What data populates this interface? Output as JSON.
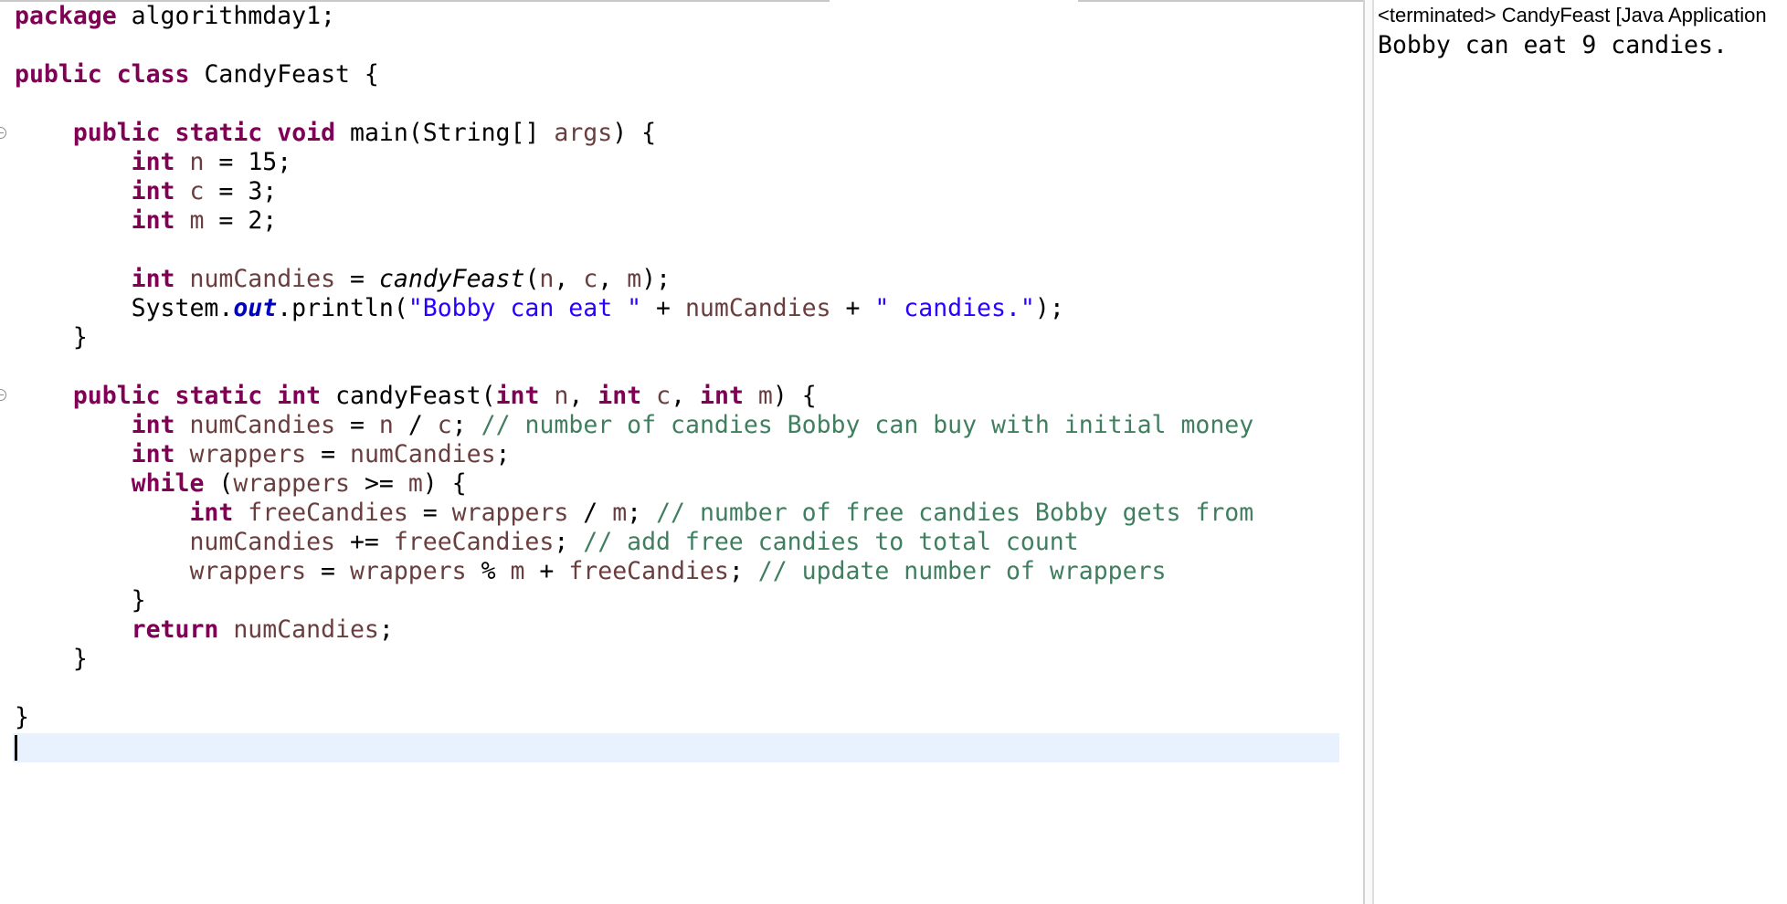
{
  "editor": {
    "lines": [
      {
        "tokens": [
          {
            "t": "package",
            "c": "kw"
          },
          {
            "t": " algorithmday1;"
          }
        ]
      },
      {
        "tokens": []
      },
      {
        "tokens": [
          {
            "t": "public",
            "c": "kw"
          },
          {
            "t": " "
          },
          {
            "t": "class",
            "c": "kw"
          },
          {
            "t": " CandyFeast {"
          }
        ]
      },
      {
        "tokens": []
      },
      {
        "tokens": [
          {
            "t": "    "
          },
          {
            "t": "public",
            "c": "kw"
          },
          {
            "t": " "
          },
          {
            "t": "static",
            "c": "kw"
          },
          {
            "t": " "
          },
          {
            "t": "void",
            "c": "kw"
          },
          {
            "t": " main(String[] "
          },
          {
            "t": "args",
            "c": "var"
          },
          {
            "t": ") {"
          }
        ]
      },
      {
        "tokens": [
          {
            "t": "        "
          },
          {
            "t": "int",
            "c": "kw"
          },
          {
            "t": " "
          },
          {
            "t": "n",
            "c": "var"
          },
          {
            "t": " = 15;"
          }
        ]
      },
      {
        "tokens": [
          {
            "t": "        "
          },
          {
            "t": "int",
            "c": "kw"
          },
          {
            "t": " "
          },
          {
            "t": "c",
            "c": "var"
          },
          {
            "t": " = 3;"
          }
        ]
      },
      {
        "tokens": [
          {
            "t": "        "
          },
          {
            "t": "int",
            "c": "kw"
          },
          {
            "t": " "
          },
          {
            "t": "m",
            "c": "var"
          },
          {
            "t": " = 2;"
          }
        ]
      },
      {
        "tokens": []
      },
      {
        "tokens": [
          {
            "t": "        "
          },
          {
            "t": "int",
            "c": "kw"
          },
          {
            "t": " "
          },
          {
            "t": "numCandies",
            "c": "var"
          },
          {
            "t": " = "
          },
          {
            "t": "candyFeast",
            "c": "ital"
          },
          {
            "t": "("
          },
          {
            "t": "n",
            "c": "var"
          },
          {
            "t": ", "
          },
          {
            "t": "c",
            "c": "var"
          },
          {
            "t": ", "
          },
          {
            "t": "m",
            "c": "var"
          },
          {
            "t": ");"
          }
        ]
      },
      {
        "tokens": [
          {
            "t": "        System."
          },
          {
            "t": "out",
            "c": "fld"
          },
          {
            "t": ".println("
          },
          {
            "t": "\"Bobby can eat \"",
            "c": "str"
          },
          {
            "t": " + "
          },
          {
            "t": "numCandies",
            "c": "var"
          },
          {
            "t": " + "
          },
          {
            "t": "\" candies.\"",
            "c": "str"
          },
          {
            "t": ");"
          }
        ]
      },
      {
        "tokens": [
          {
            "t": "    }"
          }
        ]
      },
      {
        "tokens": []
      },
      {
        "tokens": [
          {
            "t": "    "
          },
          {
            "t": "public",
            "c": "kw"
          },
          {
            "t": " "
          },
          {
            "t": "static",
            "c": "kw"
          },
          {
            "t": " "
          },
          {
            "t": "int",
            "c": "kw"
          },
          {
            "t": " candyFeast("
          },
          {
            "t": "int",
            "c": "kw"
          },
          {
            "t": " "
          },
          {
            "t": "n",
            "c": "var"
          },
          {
            "t": ", "
          },
          {
            "t": "int",
            "c": "kw"
          },
          {
            "t": " "
          },
          {
            "t": "c",
            "c": "var"
          },
          {
            "t": ", "
          },
          {
            "t": "int",
            "c": "kw"
          },
          {
            "t": " "
          },
          {
            "t": "m",
            "c": "var"
          },
          {
            "t": ") {"
          }
        ]
      },
      {
        "tokens": [
          {
            "t": "        "
          },
          {
            "t": "int",
            "c": "kw"
          },
          {
            "t": " "
          },
          {
            "t": "numCandies",
            "c": "var"
          },
          {
            "t": " = "
          },
          {
            "t": "n",
            "c": "var"
          },
          {
            "t": " / "
          },
          {
            "t": "c",
            "c": "var"
          },
          {
            "t": "; "
          },
          {
            "t": "// number of candies Bobby can buy with initial money",
            "c": "cmt"
          }
        ]
      },
      {
        "tokens": [
          {
            "t": "        "
          },
          {
            "t": "int",
            "c": "kw"
          },
          {
            "t": " "
          },
          {
            "t": "wrappers",
            "c": "var"
          },
          {
            "t": " = "
          },
          {
            "t": "numCandies",
            "c": "var"
          },
          {
            "t": ";"
          }
        ]
      },
      {
        "tokens": [
          {
            "t": "        "
          },
          {
            "t": "while",
            "c": "kw"
          },
          {
            "t": " ("
          },
          {
            "t": "wrappers",
            "c": "var"
          },
          {
            "t": " >= "
          },
          {
            "t": "m",
            "c": "var"
          },
          {
            "t": ") {"
          }
        ]
      },
      {
        "tokens": [
          {
            "t": "            "
          },
          {
            "t": "int",
            "c": "kw"
          },
          {
            "t": " "
          },
          {
            "t": "freeCandies",
            "c": "var"
          },
          {
            "t": " = "
          },
          {
            "t": "wrappers",
            "c": "var"
          },
          {
            "t": " / "
          },
          {
            "t": "m",
            "c": "var"
          },
          {
            "t": "; "
          },
          {
            "t": "// number of free candies Bobby gets from",
            "c": "cmt"
          }
        ]
      },
      {
        "tokens": [
          {
            "t": "            "
          },
          {
            "t": "numCandies",
            "c": "var"
          },
          {
            "t": " += "
          },
          {
            "t": "freeCandies",
            "c": "var"
          },
          {
            "t": "; "
          },
          {
            "t": "// add free candies to total count",
            "c": "cmt"
          }
        ]
      },
      {
        "tokens": [
          {
            "t": "            "
          },
          {
            "t": "wrappers",
            "c": "var"
          },
          {
            "t": " = "
          },
          {
            "t": "wrappers",
            "c": "var"
          },
          {
            "t": " % "
          },
          {
            "t": "m",
            "c": "var"
          },
          {
            "t": " + "
          },
          {
            "t": "freeCandies",
            "c": "var"
          },
          {
            "t": "; "
          },
          {
            "t": "// update number of wrappers",
            "c": "cmt"
          }
        ]
      },
      {
        "tokens": [
          {
            "t": "        }"
          }
        ]
      },
      {
        "tokens": [
          {
            "t": "        "
          },
          {
            "t": "return",
            "c": "kw"
          },
          {
            "t": " "
          },
          {
            "t": "numCandies",
            "c": "var"
          },
          {
            "t": ";"
          }
        ]
      },
      {
        "tokens": [
          {
            "t": "    }"
          }
        ]
      },
      {
        "tokens": []
      },
      {
        "tokens": [
          {
            "t": "}"
          }
        ]
      },
      {
        "tokens": []
      }
    ]
  },
  "console": {
    "header": "<terminated> CandyFeast [Java Application",
    "output": "Bobby can eat 9 candies."
  },
  "colors": {
    "keyword": "#7f0055",
    "variable": "#6a3e3e",
    "string": "#2a00ff",
    "comment": "#3f7f5f",
    "static_field": "#0000c0",
    "current_line": "#e8f2fe"
  }
}
